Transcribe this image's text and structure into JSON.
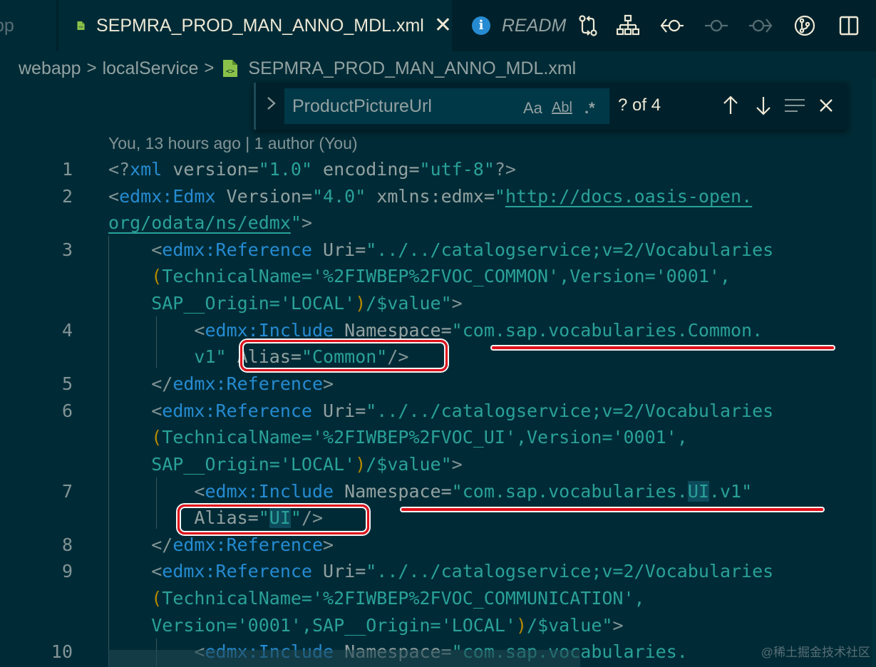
{
  "tabs": {
    "prev_label": "pp",
    "active_label": "SEPMRA_PROD_MAN_ANNO_MDL.xml",
    "readme_label": "READM",
    "close_glyph": "✕"
  },
  "toolbar": {
    "icons": [
      "compare-changes-icon",
      "source-control-graph-icon",
      "go-back-change-icon",
      "commit-node-icon",
      "go-forward-change-icon",
      "git-lens-icon",
      "split-editor-icon"
    ]
  },
  "breadcrumb": {
    "items": [
      "webapp",
      "localService",
      "SEPMRA_PROD_MAN_ANNO_MDL.xml"
    ],
    "separator": ">"
  },
  "find": {
    "value": "ProductPictureUrl",
    "match_case": "Aa",
    "whole_word": "Abl",
    "regex": ".*",
    "count": "? of 4"
  },
  "codelens": "You, 13 hours ago | 1 author (You)",
  "line_numbers": [
    "1",
    "2",
    "3",
    "4",
    "5",
    "6",
    "7",
    "8",
    "9",
    "10"
  ],
  "watermark": "@稀土掘金技术社区",
  "colors": {
    "background": "#002b36",
    "tag": "#268bd2",
    "string": "#2aa198",
    "annotation": "#e0101a"
  }
}
